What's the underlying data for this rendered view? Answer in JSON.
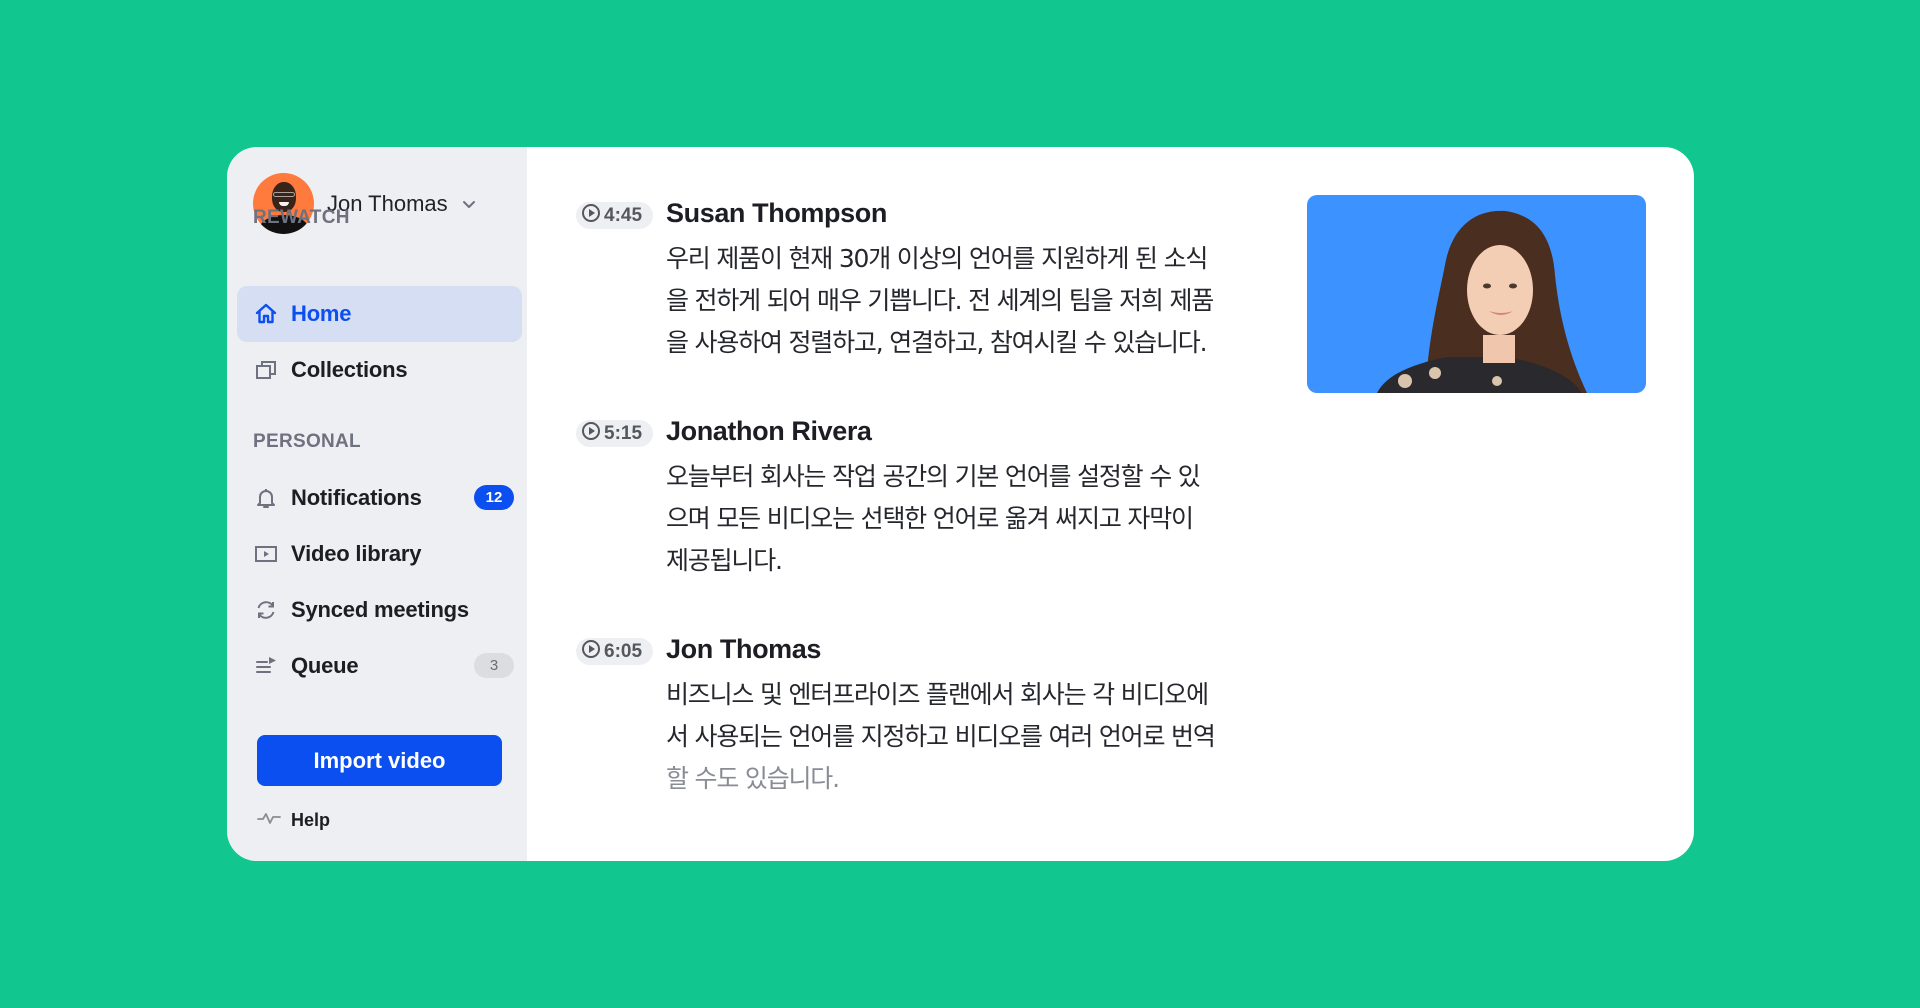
{
  "colors": {
    "background": "#12c690",
    "accent": "#0b4ff0",
    "sidebar_bg": "#eeeff2",
    "active_item_bg": "#d5def2",
    "video_bg": "#3c93ff",
    "avatar_bg": "#ff7a3d"
  },
  "user": {
    "name": "Jon Thomas",
    "avatar_icon": "user-avatar",
    "menu_icon": "chevron-down-icon"
  },
  "sidebar": {
    "sections": [
      {
        "label": "REWATCH",
        "items": [
          {
            "label": "Home",
            "icon": "home-icon",
            "active": true
          },
          {
            "label": "Collections",
            "icon": "collections-icon"
          }
        ]
      },
      {
        "label": "PERSONAL",
        "items": [
          {
            "label": "Notifications",
            "icon": "bell-icon",
            "badge": "12"
          },
          {
            "label": "Video library",
            "icon": "video-icon"
          },
          {
            "label": "Synced meetings",
            "icon": "sync-icon"
          },
          {
            "label": "Queue",
            "icon": "queue-icon",
            "badge": "3"
          }
        ]
      }
    ],
    "import_button": "Import video",
    "help_label": "Help"
  },
  "transcript": [
    {
      "timestamp": "4:45",
      "speaker": "Susan Thompson",
      "lines": [
        "우리 제품이 현재 30개 이상의 언어를 지원하게 된 소식",
        "을 전하게 되어 매우 기쁩니다. 전 세계의 팀을 저희 제품",
        "을 사용하여 정렬하고, 연결하고, 참여시킬 수 있습니다."
      ]
    },
    {
      "timestamp": "5:15",
      "speaker": "Jonathon Rivera",
      "lines": [
        "오늘부터 회사는 작업 공간의 기본 언어를 설정할 수 있",
        "으며 모든 비디오는 선택한 언어로 옮겨 써지고 자막이",
        "제공됩니다."
      ]
    },
    {
      "timestamp": "6:05",
      "speaker": "Jon Thomas",
      "lines": [
        "비즈니스 및 엔터프라이즈 플랜에서 회사는 각 비디오에",
        "서 사용되는 언어를 지정하고 비디오를 여러 언어로 번역",
        "할 수도 있습니다."
      ]
    }
  ],
  "video": {
    "subject": "Susan Thompson",
    "icon": "video-speaker-thumbnail"
  }
}
